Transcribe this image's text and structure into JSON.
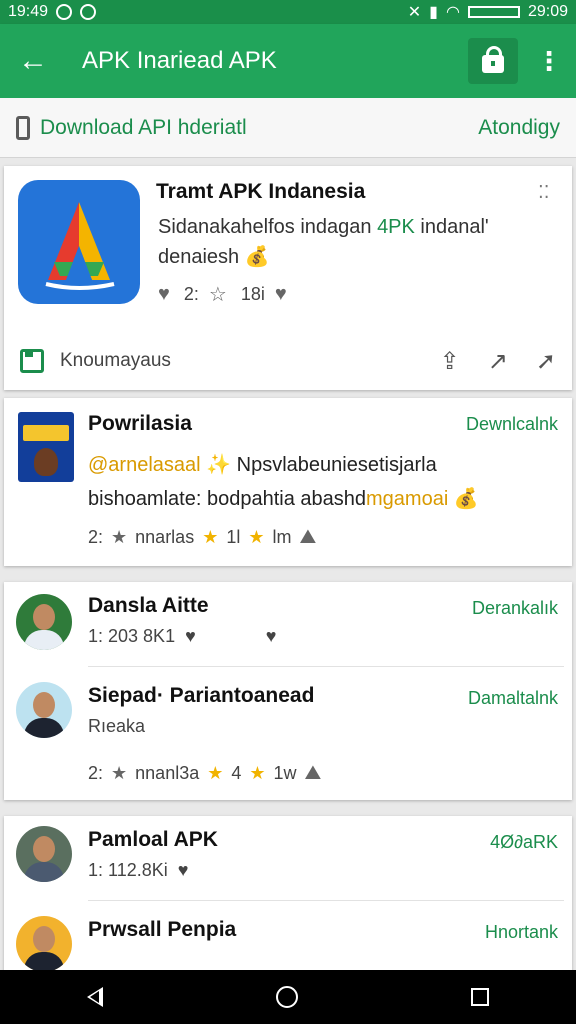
{
  "status_bar": {
    "time_left": "19:49",
    "time_right": "29:09"
  },
  "app_bar": {
    "title": "APK Inariead APK",
    "back_glyph": "←",
    "more_glyph": "⋮"
  },
  "sub_bar": {
    "label": "Download API hderiatl",
    "right_label": "Atondigy"
  },
  "featured": {
    "name": "Tramt APK Indanesia",
    "desc_part1": "Sidanakahelfos indagan ",
    "desc_highlight": "4PK",
    "desc_part2": " indanal' denaiesh",
    "desc_emoji": "💰",
    "meta_a": "2:",
    "meta_b": "18i",
    "footer_label": "Knoumayaus",
    "grip_glyph": "⁚⁚"
  },
  "post1": {
    "name": "Powrilasia",
    "download": "Dewnlcalnk",
    "line1_prefix": "@arnelasaal",
    "line1_emoji": "✨",
    "line1_suffix": "Npsvlabeuniesetisjarla",
    "line2_prefix": "bishoamlate: bodpahtia abashd",
    "line2_highlight": "mgamoai",
    "line2_emoji": "💰",
    "meta_count": "2:",
    "meta_a": "nnarlas",
    "meta_b": "1l",
    "meta_c": "lm"
  },
  "users": {
    "u1": {
      "name": "Dansla Aitte",
      "sub": "1: 203 8K1",
      "download": "Derankalık"
    },
    "u2": {
      "name": "Siepad· Pariantoanead",
      "sub": "Rıeaka",
      "download": "Damaltalnk",
      "meta_count": "2:",
      "meta_a": "nnanl3a",
      "meta_b": "4",
      "meta_c": "1w"
    },
    "u3": {
      "name": "Pamloal APK",
      "sub": "1: 112.8Ki",
      "download": "4Ø∂aRK"
    },
    "u4": {
      "name": "Prwsall Penpia",
      "download": "Hnortank"
    }
  }
}
